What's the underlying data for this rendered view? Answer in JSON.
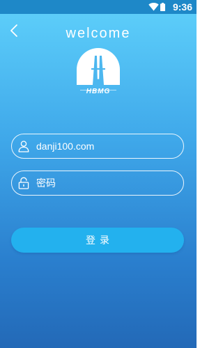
{
  "status_bar": {
    "time": "9:36",
    "wifi_icon": "wifi-icon",
    "battery_icon": "battery-icon"
  },
  "header": {
    "back_icon": "chevron-left-icon",
    "title": "welcome"
  },
  "logo": {
    "text": "HBMG"
  },
  "form": {
    "email_value": "danji100.com",
    "email_icon": "user-icon",
    "password_placeholder": "密码",
    "password_icon": "lock-icon",
    "login_label": "登录"
  },
  "colors": {
    "gradient_top": "#5fd1fb",
    "gradient_bottom": "#2369b7",
    "button": "#23b1ee",
    "status_bar": "#1e88c8"
  }
}
